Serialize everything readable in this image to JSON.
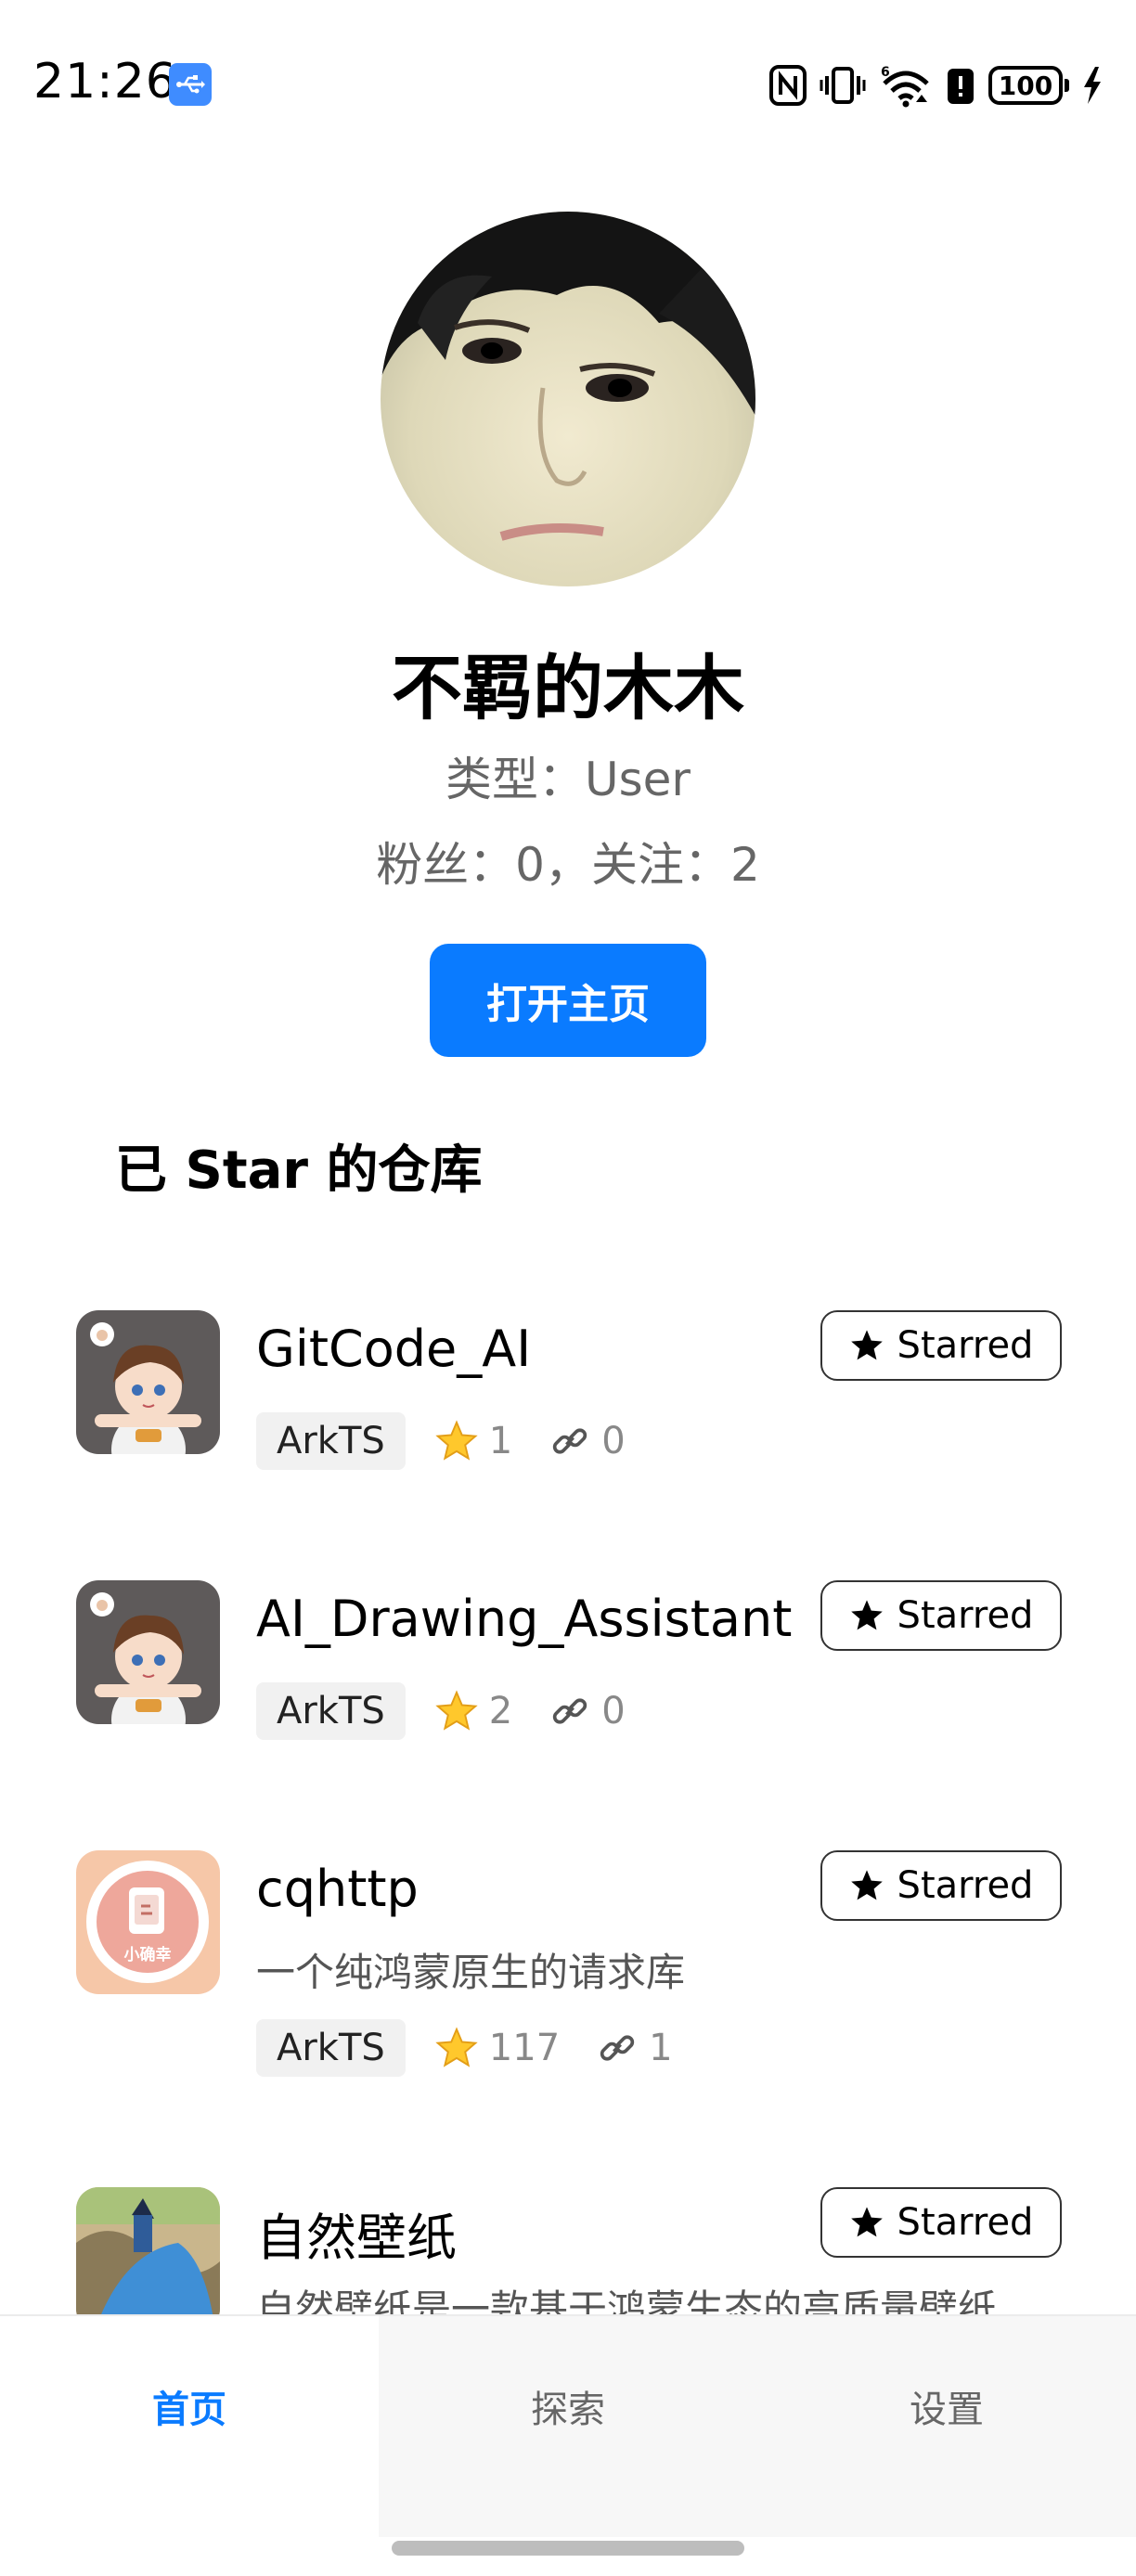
{
  "status_bar": {
    "time": "21:26",
    "battery": "100",
    "icons": [
      "usb-icon",
      "nfc-icon",
      "vibrate-icon",
      "wifi-6-icon",
      "battery-saver-icon",
      "battery-icon",
      "charging-icon"
    ]
  },
  "profile": {
    "name": "不羁的木木",
    "type_line": "类型：User",
    "stats_line": "粉丝：0，关注：2",
    "open_button": "打开主页"
  },
  "section": {
    "title": "已 Star 的仓库"
  },
  "repos": [
    {
      "name": "GitCode_AI",
      "description": "",
      "language": "ArkTS",
      "stars": "1",
      "forks": "0",
      "star_button": "Starred",
      "icon": "anime-boy-avatar-icon"
    },
    {
      "name": "AI_Drawing_Assistant",
      "description": "",
      "language": "ArkTS",
      "stars": "2",
      "forks": "0",
      "star_button": "Starred",
      "icon": "anime-boy-avatar-icon"
    },
    {
      "name": "cqhttp",
      "description": "一个纯鸿蒙原生的请求库",
      "language": "ArkTS",
      "stars": "117",
      "forks": "1",
      "star_button": "Starred",
      "icon": "xiaoyiji-app-icon",
      "icon_label": "小确幸"
    },
    {
      "name": "自然壁纸",
      "description": "自然壁纸是一款基于鸿蒙生态的高质量壁纸",
      "star_button": "Starred",
      "icon": "nature-wallpaper-icon"
    }
  ],
  "tabs": [
    {
      "label": "首页",
      "active": true
    },
    {
      "label": "探索",
      "active": false
    },
    {
      "label": "设置",
      "active": false
    }
  ],
  "colors": {
    "accent": "#0a7bff",
    "secondary_text": "#666666",
    "tag_bg": "#f1f1f1"
  }
}
